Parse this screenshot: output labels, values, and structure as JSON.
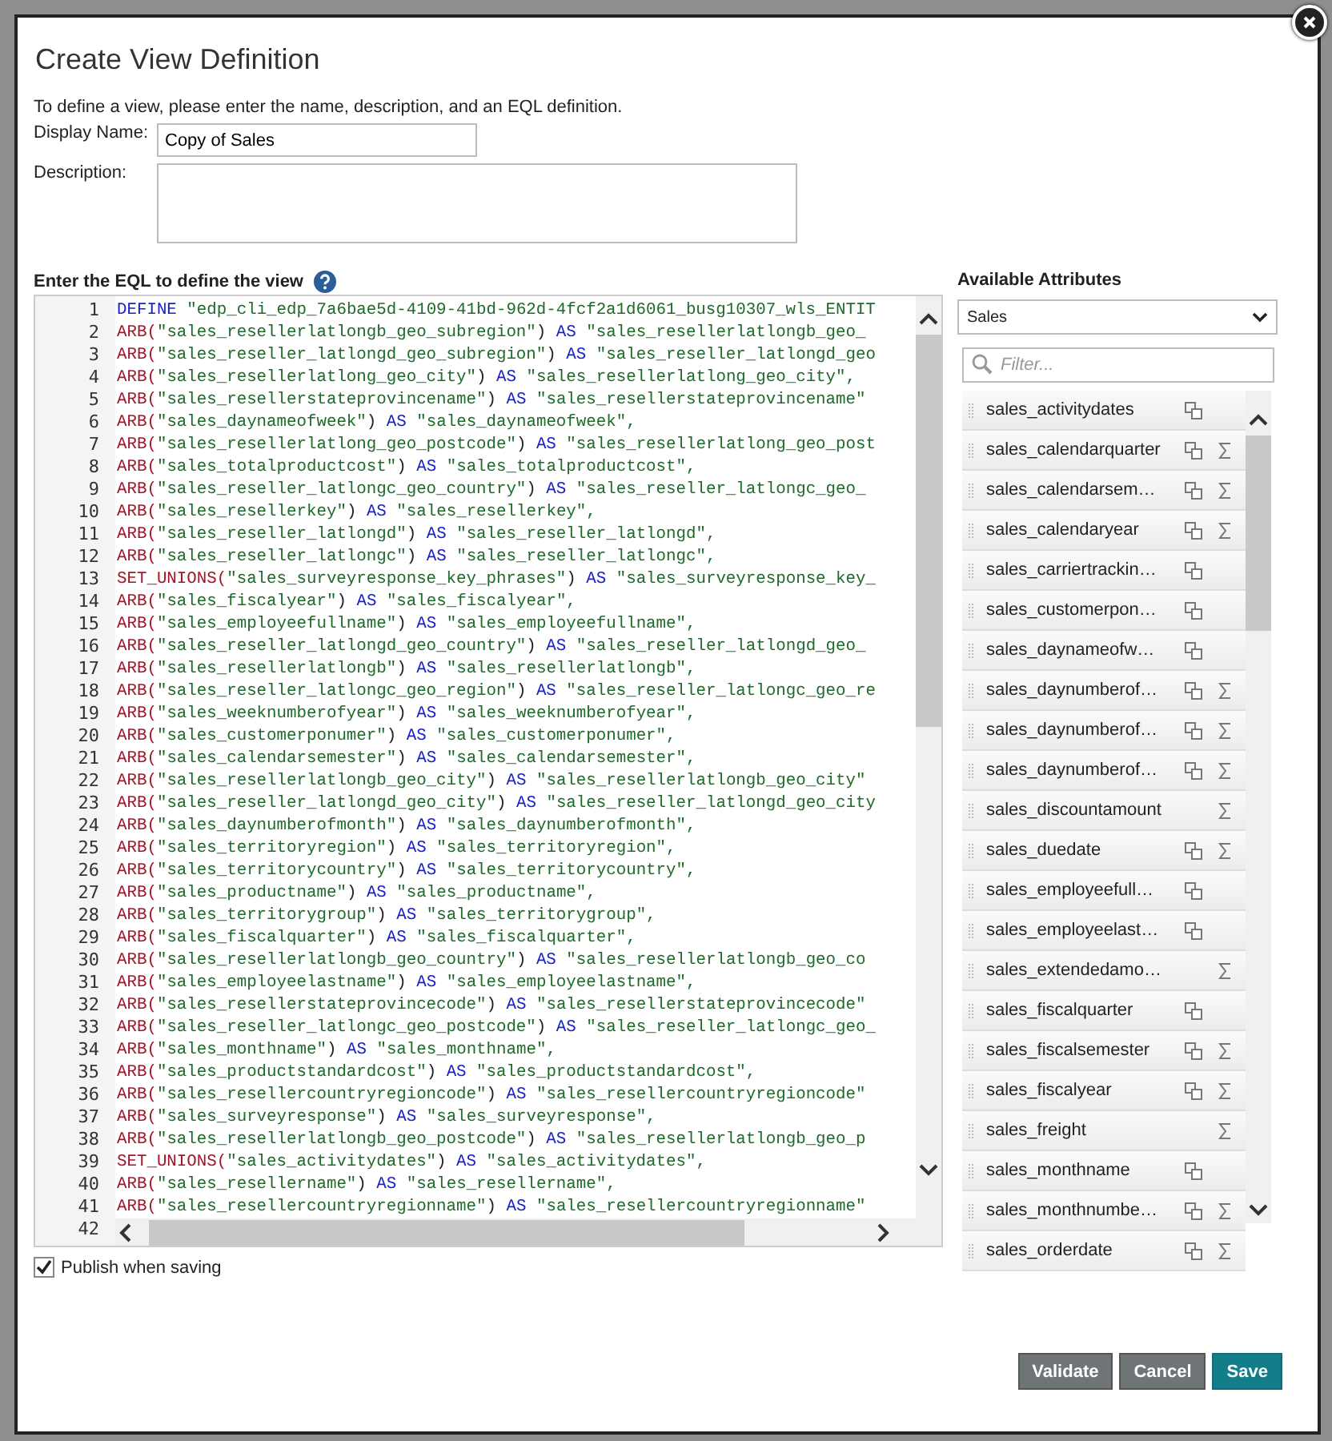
{
  "dialog": {
    "title": "Create View Definition",
    "intro": "To define a view, please enter the name, description, and an EQL definition.",
    "display_name": {
      "label": "Display Name:",
      "value": "Copy of Sales"
    },
    "description": {
      "label": "Description:"
    },
    "eql": {
      "label": "Enter the EQL to define the view",
      "lines": [
        {
          "number": "1",
          "keyword": "DEFINE",
          "alias": "\"edp_cli_edp_7a6bae5d-4109-41bd-962d-4fcf2a1d6061_busg10307_wls_ENTIT"
        },
        {
          "number": "2",
          "func": "ARB(",
          "arg": "\"sales_resellerlatlongb_geo_subregion\"",
          "close": ")",
          "keyword": "AS",
          "alias": "\"sales_resellerlatlongb_geo_"
        },
        {
          "number": "3",
          "func": "ARB(",
          "arg": "\"sales_reseller_latlongd_geo_subregion\"",
          "close": ")",
          "keyword": "AS",
          "alias": "\"sales_reseller_latlongd_geo"
        },
        {
          "number": "4",
          "func": "ARB(",
          "arg": "\"sales_resellerlatlong_geo_city\"",
          "close": ")",
          "keyword": "AS",
          "alias": "\"sales_resellerlatlong_geo_city\","
        },
        {
          "number": "5",
          "func": "ARB(",
          "arg": "\"sales_resellerstateprovincename\"",
          "close": ")",
          "keyword": "AS",
          "alias": "\"sales_resellerstateprovincename\""
        },
        {
          "number": "6",
          "func": "ARB(",
          "arg": "\"sales_daynameofweek\"",
          "close": ")",
          "keyword": "AS",
          "alias": "\"sales_daynameofweek\","
        },
        {
          "number": "7",
          "func": "ARB(",
          "arg": "\"sales_resellerlatlong_geo_postcode\"",
          "close": ")",
          "keyword": "AS",
          "alias": "\"sales_resellerlatlong_geo_post"
        },
        {
          "number": "8",
          "func": "ARB(",
          "arg": "\"sales_totalproductcost\"",
          "close": ")",
          "keyword": "AS",
          "alias": "\"sales_totalproductcost\","
        },
        {
          "number": "9",
          "func": "ARB(",
          "arg": "\"sales_reseller_latlongc_geo_country\"",
          "close": ")",
          "keyword": "AS",
          "alias": "\"sales_reseller_latlongc_geo_"
        },
        {
          "number": "10",
          "func": "ARB(",
          "arg": "\"sales_resellerkey\"",
          "close": ")",
          "keyword": "AS",
          "alias": "\"sales_resellerkey\","
        },
        {
          "number": "11",
          "func": "ARB(",
          "arg": "\"sales_reseller_latlongd\"",
          "close": ")",
          "keyword": "AS",
          "alias": "\"sales_reseller_latlongd\","
        },
        {
          "number": "12",
          "func": "ARB(",
          "arg": "\"sales_reseller_latlongc\"",
          "close": ")",
          "keyword": "AS",
          "alias": "\"sales_reseller_latlongc\","
        },
        {
          "number": "13",
          "func": "SET_UNIONS(",
          "arg": "\"sales_surveyresponse_key_phrases\"",
          "close": ")",
          "keyword": "AS",
          "alias": "\"sales_surveyresponse_key_"
        },
        {
          "number": "14",
          "func": "ARB(",
          "arg": "\"sales_fiscalyear\"",
          "close": ")",
          "keyword": "AS",
          "alias": "\"sales_fiscalyear\","
        },
        {
          "number": "15",
          "func": "ARB(",
          "arg": "\"sales_employeefullname\"",
          "close": ")",
          "keyword": "AS",
          "alias": "\"sales_employeefullname\","
        },
        {
          "number": "16",
          "func": "ARB(",
          "arg": "\"sales_reseller_latlongd_geo_country\"",
          "close": ")",
          "keyword": "AS",
          "alias": "\"sales_reseller_latlongd_geo_"
        },
        {
          "number": "17",
          "func": "ARB(",
          "arg": "\"sales_resellerlatlongb\"",
          "close": ")",
          "keyword": "AS",
          "alias": "\"sales_resellerlatlongb\","
        },
        {
          "number": "18",
          "func": "ARB(",
          "arg": "\"sales_reseller_latlongc_geo_region\"",
          "close": ")",
          "keyword": "AS",
          "alias": "\"sales_reseller_latlongc_geo_re"
        },
        {
          "number": "19",
          "func": "ARB(",
          "arg": "\"sales_weeknumberofyear\"",
          "close": ")",
          "keyword": "AS",
          "alias": "\"sales_weeknumberofyear\","
        },
        {
          "number": "20",
          "func": "ARB(",
          "arg": "\"sales_customerponumer\"",
          "close": ")",
          "keyword": "AS",
          "alias": "\"sales_customerponumer\","
        },
        {
          "number": "21",
          "func": "ARB(",
          "arg": "\"sales_calendarsemester\"",
          "close": ")",
          "keyword": "AS",
          "alias": "\"sales_calendarsemester\","
        },
        {
          "number": "22",
          "func": "ARB(",
          "arg": "\"sales_resellerlatlongb_geo_city\"",
          "close": ")",
          "keyword": "AS",
          "alias": "\"sales_resellerlatlongb_geo_city\""
        },
        {
          "number": "23",
          "func": "ARB(",
          "arg": "\"sales_reseller_latlongd_geo_city\"",
          "close": ")",
          "keyword": "AS",
          "alias": "\"sales_reseller_latlongd_geo_city"
        },
        {
          "number": "24",
          "func": "ARB(",
          "arg": "\"sales_daynumberofmonth\"",
          "close": ")",
          "keyword": "AS",
          "alias": "\"sales_daynumberofmonth\","
        },
        {
          "number": "25",
          "func": "ARB(",
          "arg": "\"sales_territoryregion\"",
          "close": ")",
          "keyword": "AS",
          "alias": "\"sales_territoryregion\","
        },
        {
          "number": "26",
          "func": "ARB(",
          "arg": "\"sales_territorycountry\"",
          "close": ")",
          "keyword": "AS",
          "alias": "\"sales_territorycountry\","
        },
        {
          "number": "27",
          "func": "ARB(",
          "arg": "\"sales_productname\"",
          "close": ")",
          "keyword": "AS",
          "alias": "\"sales_productname\","
        },
        {
          "number": "28",
          "func": "ARB(",
          "arg": "\"sales_territorygroup\"",
          "close": ")",
          "keyword": "AS",
          "alias": "\"sales_territorygroup\","
        },
        {
          "number": "29",
          "func": "ARB(",
          "arg": "\"sales_fiscalquarter\"",
          "close": ")",
          "keyword": "AS",
          "alias": "\"sales_fiscalquarter\","
        },
        {
          "number": "30",
          "func": "ARB(",
          "arg": "\"sales_resellerlatlongb_geo_country\"",
          "close": ")",
          "keyword": "AS",
          "alias": "\"sales_resellerlatlongb_geo_co"
        },
        {
          "number": "31",
          "func": "ARB(",
          "arg": "\"sales_employeelastname\"",
          "close": ")",
          "keyword": "AS",
          "alias": "\"sales_employeelastname\","
        },
        {
          "number": "32",
          "func": "ARB(",
          "arg": "\"sales_resellerstateprovincecode\"",
          "close": ")",
          "keyword": "AS",
          "alias": "\"sales_resellerstateprovincecode\""
        },
        {
          "number": "33",
          "func": "ARB(",
          "arg": "\"sales_reseller_latlongc_geo_postcode\"",
          "close": ")",
          "keyword": "AS",
          "alias": "\"sales_reseller_latlongc_geo_"
        },
        {
          "number": "34",
          "func": "ARB(",
          "arg": "\"sales_monthname\"",
          "close": ")",
          "keyword": "AS",
          "alias": "\"sales_monthname\","
        },
        {
          "number": "35",
          "func": "ARB(",
          "arg": "\"sales_productstandardcost\"",
          "close": ")",
          "keyword": "AS",
          "alias": "\"sales_productstandardcost\","
        },
        {
          "number": "36",
          "func": "ARB(",
          "arg": "\"sales_resellercountryregioncode\"",
          "close": ")",
          "keyword": "AS",
          "alias": "\"sales_resellercountryregioncode\""
        },
        {
          "number": "37",
          "func": "ARB(",
          "arg": "\"sales_surveyresponse\"",
          "close": ")",
          "keyword": "AS",
          "alias": "\"sales_surveyresponse\","
        },
        {
          "number": "38",
          "func": "ARB(",
          "arg": "\"sales_resellerlatlongb_geo_postcode\"",
          "close": ")",
          "keyword": "AS",
          "alias": "\"sales_resellerlatlongb_geo_p"
        },
        {
          "number": "39",
          "func": "SET_UNIONS(",
          "arg": "\"sales_activitydates\"",
          "close": ")",
          "keyword": "AS",
          "alias": "\"sales_activitydates\","
        },
        {
          "number": "40",
          "func": "ARB(",
          "arg": "\"sales_resellername\"",
          "close": ")",
          "keyword": "AS",
          "alias": "\"sales_resellername\","
        },
        {
          "number": "41",
          "func": "ARB(",
          "arg": "\"sales_resellercountryregionname\"",
          "close": ")",
          "keyword": "AS",
          "alias": "\"sales_resellercountryregionname\""
        },
        {
          "number": "42"
        }
      ]
    },
    "attributes": {
      "label": "Available Attributes",
      "source": "Sales",
      "filter_placeholder": "Filter...",
      "items": [
        {
          "name": "sales_activitydates",
          "copy": true,
          "sum": false
        },
        {
          "name": "sales_calendarquarter",
          "copy": true,
          "sum": true
        },
        {
          "name": "sales_calendarsem…",
          "copy": true,
          "sum": true
        },
        {
          "name": "sales_calendaryear",
          "copy": true,
          "sum": true
        },
        {
          "name": "sales_carriertrackin…",
          "copy": true,
          "sum": false
        },
        {
          "name": "sales_customerpon…",
          "copy": true,
          "sum": false
        },
        {
          "name": "sales_daynameofw…",
          "copy": true,
          "sum": false
        },
        {
          "name": "sales_daynumberof…",
          "copy": true,
          "sum": true
        },
        {
          "name": "sales_daynumberof…",
          "copy": true,
          "sum": true
        },
        {
          "name": "sales_daynumberof…",
          "copy": true,
          "sum": true
        },
        {
          "name": "sales_discountamount",
          "copy": false,
          "sum": true
        },
        {
          "name": "sales_duedate",
          "copy": true,
          "sum": true
        },
        {
          "name": "sales_employeefull…",
          "copy": true,
          "sum": false
        },
        {
          "name": "sales_employeelast…",
          "copy": true,
          "sum": false
        },
        {
          "name": "sales_extendedamo…",
          "copy": false,
          "sum": true
        },
        {
          "name": "sales_fiscalquarter",
          "copy": true,
          "sum": false
        },
        {
          "name": "sales_fiscalsemester",
          "copy": true,
          "sum": true
        },
        {
          "name": "sales_fiscalyear",
          "copy": true,
          "sum": true
        },
        {
          "name": "sales_freight",
          "copy": false,
          "sum": true
        },
        {
          "name": "sales_monthname",
          "copy": true,
          "sum": false
        },
        {
          "name": "sales_monthnumbe…",
          "copy": true,
          "sum": true
        },
        {
          "name": "sales_orderdate",
          "copy": true,
          "sum": true
        }
      ]
    },
    "publish": {
      "label": "Publish when saving",
      "checked": true
    },
    "buttons": [
      {
        "label": "Validate",
        "kind": "secondary"
      },
      {
        "label": "Cancel",
        "kind": "secondary"
      },
      {
        "label": "Save",
        "kind": "primary"
      }
    ]
  }
}
